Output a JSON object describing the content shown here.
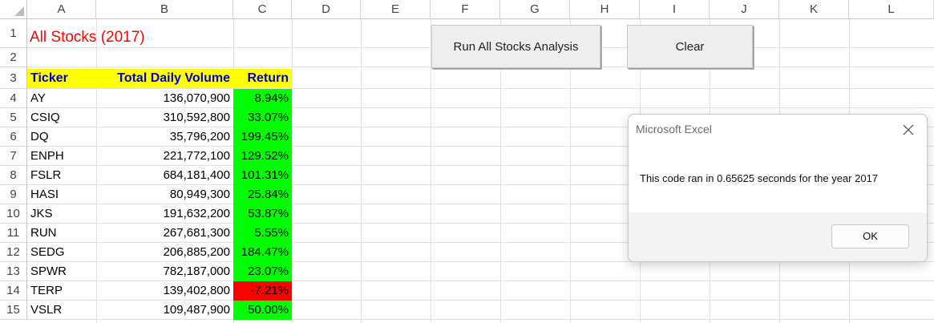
{
  "spreadsheet": {
    "columns": [
      "A",
      "B",
      "C",
      "D",
      "E",
      "F",
      "G",
      "H",
      "I",
      "J",
      "K",
      "L"
    ],
    "rows": [
      "1",
      "2",
      "3",
      "4",
      "5",
      "6",
      "7",
      "8",
      "9",
      "10",
      "11",
      "12",
      "13",
      "14",
      "15"
    ],
    "title": "All Stocks (2017)",
    "headers": {
      "ticker": "Ticker",
      "volume": "Total Daily Volume",
      "return": "Return"
    },
    "return_colors": {
      "positive": "#00ff00",
      "negative": "#ff0000",
      "header": "#ffff00",
      "header_text": "#0000cc",
      "title_text": "#ff0000"
    },
    "stocks": [
      {
        "ticker": "AY",
        "volume": "136,070,900",
        "return": "8.94%"
      },
      {
        "ticker": "CSIQ",
        "volume": "310,592,800",
        "return": "33.07%"
      },
      {
        "ticker": "DQ",
        "volume": "35,796,200",
        "return": "199.45%"
      },
      {
        "ticker": "ENPH",
        "volume": "221,772,100",
        "return": "129.52%"
      },
      {
        "ticker": "FSLR",
        "volume": "684,181,400",
        "return": "101.31%"
      },
      {
        "ticker": "HASI",
        "volume": "80,949,300",
        "return": "25.84%"
      },
      {
        "ticker": "JKS",
        "volume": "191,632,200",
        "return": "53.87%"
      },
      {
        "ticker": "RUN",
        "volume": "267,681,300",
        "return": "5.55%"
      },
      {
        "ticker": "SEDG",
        "volume": "206,885,200",
        "return": "184.47%"
      },
      {
        "ticker": "SPWR",
        "volume": "782,187,000",
        "return": "23.07%"
      },
      {
        "ticker": "TERP",
        "volume": "139,402,800",
        "return": "-7.21%"
      },
      {
        "ticker": "VSLR",
        "volume": "109,487,900",
        "return": "50.00%"
      }
    ]
  },
  "buttons": {
    "run_label": "Run All Stocks Analysis",
    "clear_label": "Clear"
  },
  "dialog": {
    "title": "Microsoft Excel",
    "message": "This code ran in 0.65625 seconds for the year 2017",
    "ok_label": "OK",
    "close_icon": "close-icon"
  }
}
